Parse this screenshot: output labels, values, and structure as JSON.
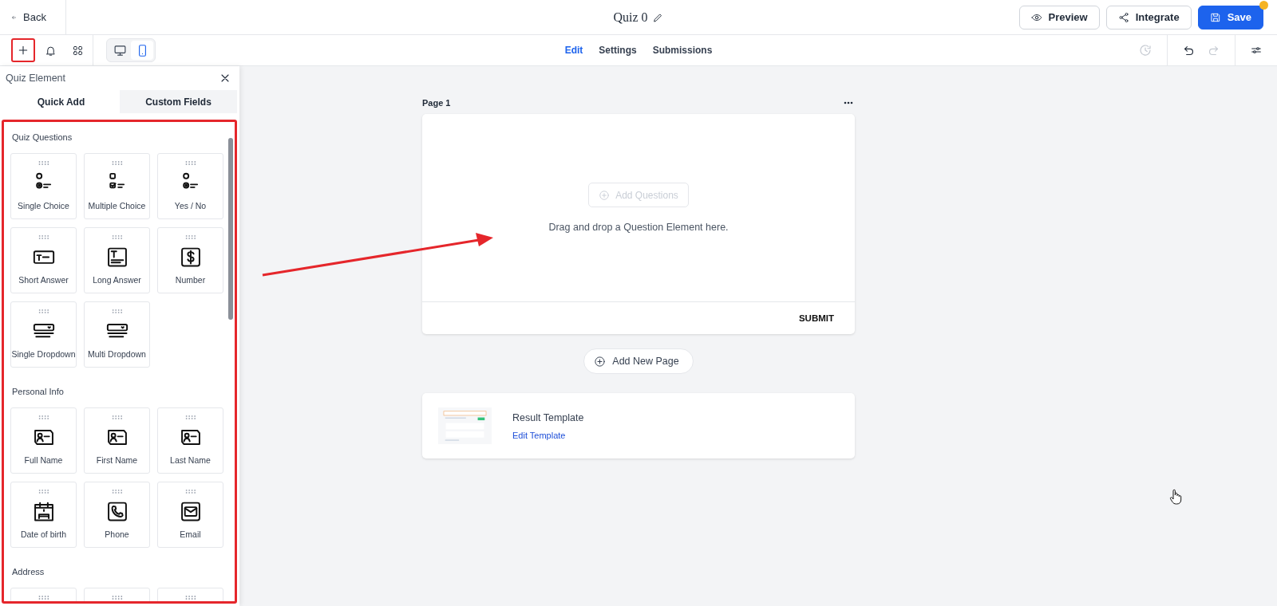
{
  "header": {
    "back": "Back",
    "title": "Quiz 0",
    "buttons": [
      {
        "label": "Preview",
        "kind": "preview",
        "notification_dot": false
      },
      {
        "label": "Integrate",
        "kind": "integrate",
        "notification_dot": false
      },
      {
        "label": "Save",
        "kind": "save",
        "notification_dot": true
      }
    ]
  },
  "toolbar": {
    "tools": [
      {
        "kind": "add",
        "highlighted": true
      },
      {
        "kind": "bell",
        "highlighted": false
      },
      {
        "kind": "grid",
        "highlighted": false
      }
    ],
    "devices": [
      {
        "kind": "desktop",
        "selected": false
      },
      {
        "kind": "mobile",
        "selected": true
      }
    ],
    "tabs": [
      {
        "label": "Edit",
        "selected": true
      },
      {
        "label": "Settings",
        "selected": false
      },
      {
        "label": "Submissions",
        "selected": false
      }
    ],
    "undo_disabled": false,
    "redo_disabled": true
  },
  "panel": {
    "title": "Quiz Element",
    "highlighted": true,
    "tabs": [
      {
        "label": "Quick Add",
        "selected": true
      },
      {
        "label": "Custom Fields",
        "selected": false
      }
    ],
    "sections": [
      {
        "title": "Quiz Questions",
        "tiles": [
          {
            "label": "Single Choice",
            "kind": "radio"
          },
          {
            "label": "Multiple Choice",
            "kind": "checkbox"
          },
          {
            "label": "Yes / No",
            "kind": "radio"
          },
          {
            "label": "Short Answer",
            "kind": "text"
          },
          {
            "label": "Long Answer",
            "kind": "textarea"
          },
          {
            "label": "Number",
            "kind": "number"
          },
          {
            "label": "Single Dropdown",
            "kind": "dropdown"
          },
          {
            "label": "Multi Dropdown",
            "kind": "dropdown"
          }
        ]
      },
      {
        "title": "Personal Info",
        "tiles": [
          {
            "label": "Full Name",
            "kind": "name"
          },
          {
            "label": "First Name",
            "kind": "name"
          },
          {
            "label": "Last Name",
            "kind": "name"
          },
          {
            "label": "Date of birth",
            "kind": "calendar"
          },
          {
            "label": "Phone",
            "kind": "phone"
          },
          {
            "label": "Email",
            "kind": "email"
          }
        ]
      },
      {
        "title": "Address",
        "tiles": [
          {
            "kind": "cut"
          },
          {
            "kind": "cut"
          },
          {
            "kind": "cut"
          }
        ]
      }
    ]
  },
  "canvas": {
    "page_label": "Page 1",
    "add_questions": {
      "label": "Add Questions",
      "disabled": true
    },
    "drop_hint": "Drag and drop a Question Element here.",
    "submit": "SUBMIT",
    "add_page": "Add New Page",
    "result": {
      "title": "Result Template",
      "link": "Edit Template"
    }
  },
  "annotation_arrow": true
}
